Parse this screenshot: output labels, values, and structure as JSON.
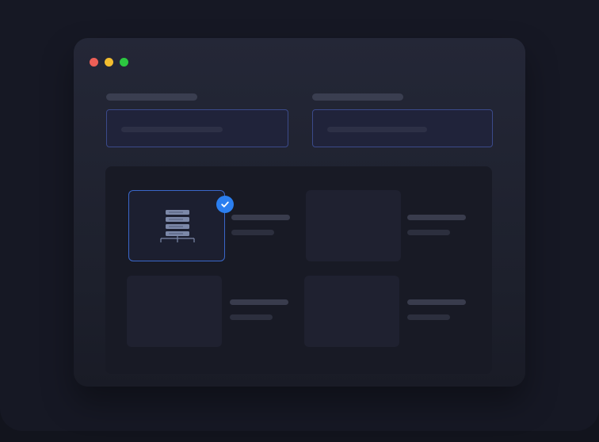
{
  "window": {
    "controls": [
      "close",
      "minimize",
      "maximize"
    ]
  },
  "form": {
    "fields": [
      {
        "label": "",
        "placeholder": ""
      },
      {
        "label": "",
        "placeholder": ""
      }
    ]
  },
  "options": {
    "items": [
      {
        "icon": "server-database-icon",
        "selected": true
      },
      {
        "icon": "",
        "selected": false
      },
      {
        "icon": "",
        "selected": false
      },
      {
        "icon": "",
        "selected": false
      }
    ]
  },
  "colors": {
    "accent": "#2b7ff0",
    "selected_border": "#3a67c9",
    "field_border": "#3b4a8a",
    "close": "#ed5f57",
    "minimize": "#f3bd2f",
    "maximize": "#2cc840"
  }
}
